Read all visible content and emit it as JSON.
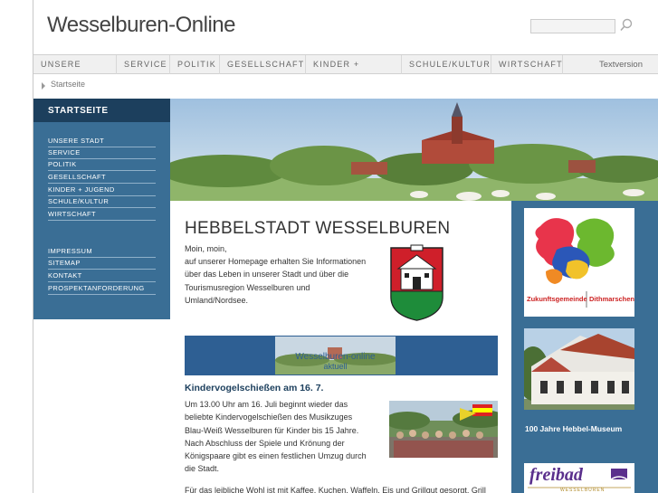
{
  "header": {
    "site_title": "Wesselburen-Online",
    "search_placeholder": ""
  },
  "topnav": {
    "items": [
      "UNSERE STADT",
      "SERVICE",
      "POLITIK",
      "GESELLSCHAFT",
      "KINDER + JUGEND",
      "SCHULE/KULTUR",
      "WIRTSCHAFT"
    ],
    "textversion": "Textversion"
  },
  "breadcrumb": {
    "current": "Startseite"
  },
  "sidebar": {
    "heading": "STARTSEITE",
    "primary": [
      "UNSERE STADT",
      "SERVICE",
      "POLITIK",
      "GESELLSCHAFT",
      "KINDER + JUGEND",
      "SCHULE/KULTUR",
      "WIRTSCHAFT"
    ],
    "secondary": [
      "IMPRESSUM",
      "SITEMAP",
      "KONTAKT",
      "PROSPEKTANFORDERUNG"
    ]
  },
  "main": {
    "title": "HEBBELSTADT WESSELBUREN",
    "intro_lines": [
      "Moin, moin,",
      "auf unserer Homepage erhalten Sie Informationen",
      "über das Leben in unserer Stadt und über die",
      "Tourismusregion Wesselburen und",
      "Umland/Nordsee."
    ],
    "banner": {
      "line1": "Wesselburen-online",
      "line2": "aktuell"
    },
    "news": {
      "heading": "Kindervogelschießen am 16. 7.",
      "lines": [
        "Um 13.00 Uhr am 16. Juli beginnt wieder das",
        "beliebte Kindervogelschießen des Musikzuges",
        "Blau-Weiß Wesselburen für Kinder bis 15 Jahre.",
        "Nach Abschluss der Spiele und Krönung der",
        "Königspaare gibt es einen festlichen Umzug durch",
        "die Stadt."
      ],
      "cut_line": "Für das leibliche Wohl ist mit Kaffee, Kuchen, Waffeln, Eis und Grillgut gesorgt. Grill"
    }
  },
  "right": {
    "logo1": {
      "line_left": "Zukunftsgemeinde",
      "line_right": "Dithmarschen"
    },
    "caption": "100 Jahre Hebbel-Museum",
    "logo3": {
      "text": "freibad",
      "sub": "WESSELBUREN"
    }
  },
  "colors": {
    "sidebar_blue": "#3a6e95",
    "sidebar_dark": "#1c3f5d",
    "banner_blue": "#2e5f93"
  }
}
